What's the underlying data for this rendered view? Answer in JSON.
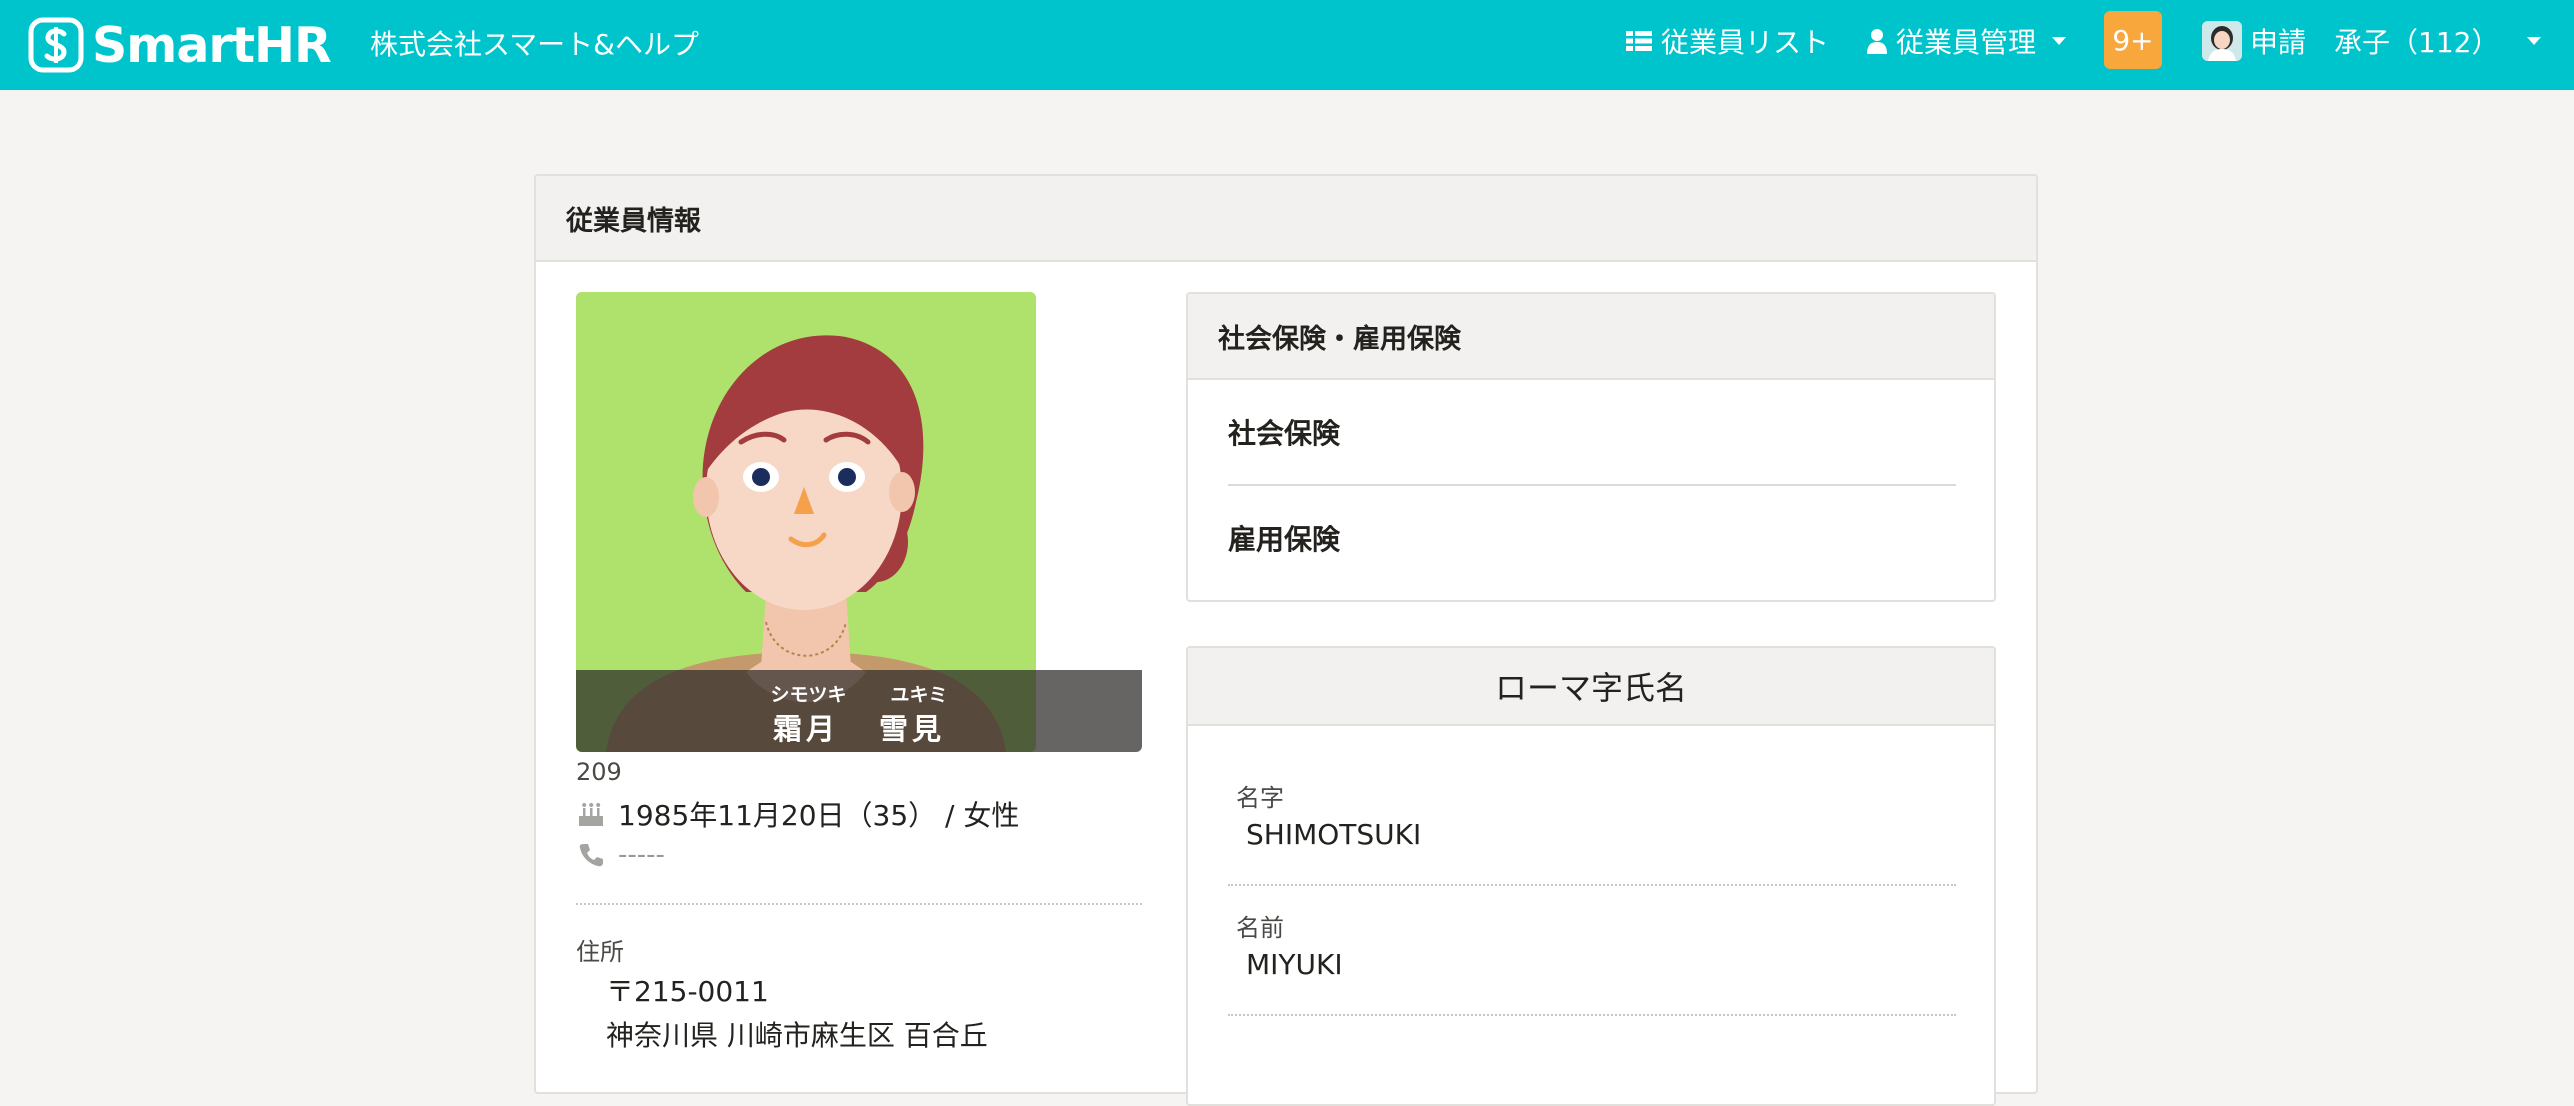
{
  "header": {
    "logo_text": "SmartHR",
    "company": "株式会社スマート&ヘルプ",
    "nav": {
      "employee_list": "従業員リスト",
      "employee_manage": "従業員管理"
    },
    "badge": "9+",
    "user": "申請　承子（112）"
  },
  "panel": {
    "title": "従業員情報"
  },
  "profile": {
    "name_kana_last": "シモツキ",
    "name_kana_first": "ユキミ",
    "name_last": "霜月",
    "name_first": "雪見",
    "employee_no": "209",
    "birth_gender": "1985年11月20日（35） / 女性",
    "phone": "-----",
    "address_label": "住所",
    "address_zip": "〒215-0011",
    "address_main": "神奈川県 川崎市麻生区 百合丘"
  },
  "insurance_card": {
    "title": "社会保険・雇用保険",
    "items": [
      "社会保険",
      "雇用保険"
    ]
  },
  "roman_card": {
    "title": "ローマ字氏名",
    "last_label": "名字",
    "last_value": "SHIMOTSUKI",
    "first_label": "名前",
    "first_value": "MIYUKI"
  },
  "colors": {
    "header_bg": "#00c4cc",
    "badge_bg": "#f8a73d",
    "photo_bg": "#aee26c"
  },
  "icons": [
    "smarthr-logo-icon",
    "list-icon",
    "user-icon",
    "chevron-down-icon",
    "birthday-cake-icon",
    "phone-icon"
  ]
}
